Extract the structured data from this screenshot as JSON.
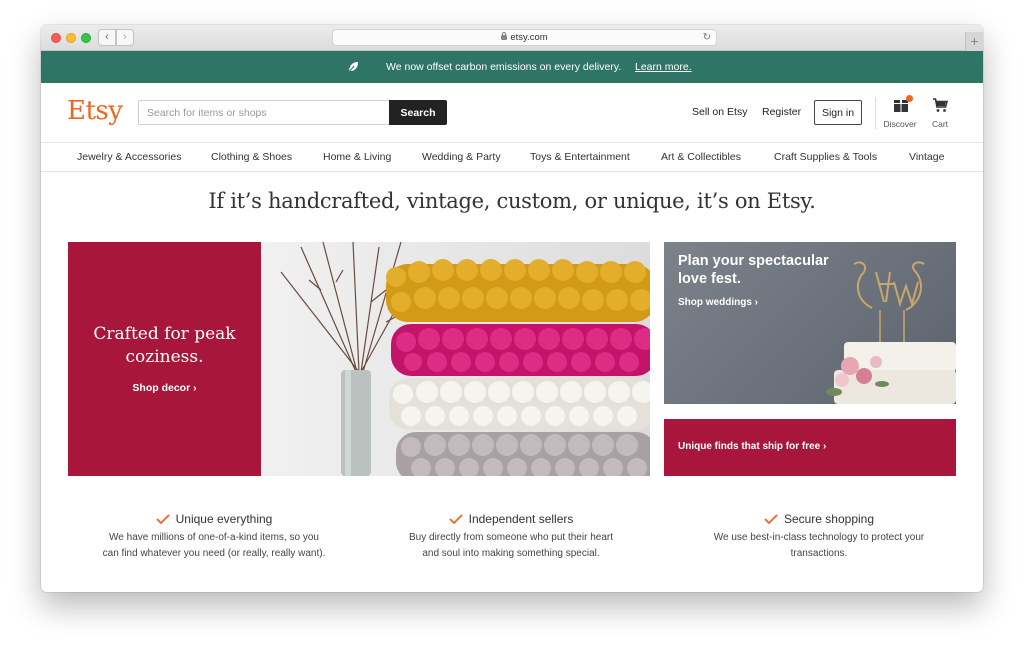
{
  "browser": {
    "url": "etsy.com",
    "back_label": "‹",
    "forward_label": "›",
    "reload_glyph": "↻",
    "newtab_glyph": "+"
  },
  "banner": {
    "text": "We now offset carbon emissions on every delivery.",
    "link": "Learn more.",
    "color": "#2f7565"
  },
  "header": {
    "logo": "Etsy",
    "logo_color": "#f1641e",
    "search_placeholder": "Search for items or shops",
    "search_button": "Search",
    "sell_link": "Sell on Etsy",
    "register_link": "Register",
    "signin_button": "Sign in",
    "discover_label": "Discover",
    "cart_label": "Cart"
  },
  "categories": [
    "Jewelry & Accessories",
    "Clothing & Shoes",
    "Home & Living",
    "Wedding & Party",
    "Toys & Entertainment",
    "Art & Collectibles",
    "Craft Supplies & Tools",
    "Vintage"
  ],
  "headline": "If it’s handcrafted, vintage, custom, or unique, it’s on Etsy.",
  "hero": {
    "title_line1": "Crafted for peak",
    "title_line2": "coziness.",
    "link": "Shop decor  ›",
    "color": "#a8163b"
  },
  "wedding_card": {
    "title": "Plan your spectacular love fest.",
    "link": "Shop weddings  ›"
  },
  "shipping_card": {
    "link": "Unique finds that ship for free  ›"
  },
  "value_props": [
    {
      "title": "Unique everything",
      "desc_line1": "We have millions of one-of-a-kind items, so you",
      "desc_line2": "can find whatever you need (or really, really want)."
    },
    {
      "title": "Independent sellers",
      "desc_line1": "Buy directly from someone who put their heart",
      "desc_line2": "and soul into making something special."
    },
    {
      "title": "Secure shopping",
      "desc_line1": "We use best-in-class technology to protect your",
      "desc_line2": "transactions."
    }
  ]
}
